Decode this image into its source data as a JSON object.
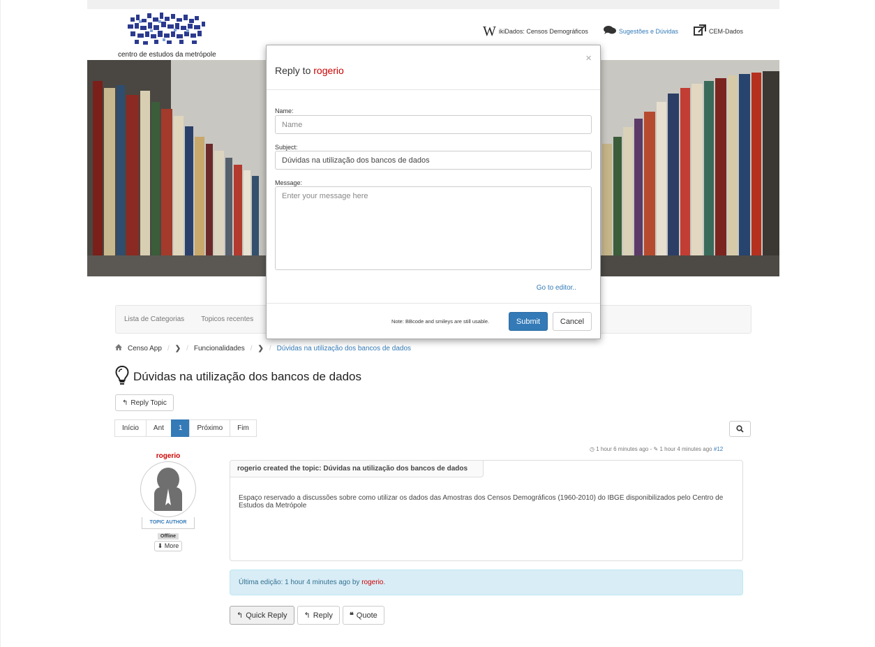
{
  "header": {
    "logo_text": "centro de estudos da metrópole",
    "links": [
      {
        "icon": "wikipedia-w-icon",
        "glyph": "W",
        "label": "ikiDados: Censos Demográficos"
      },
      {
        "icon": "comments-icon",
        "glyph": "💬",
        "label": "Sugestões e Dúvidas"
      },
      {
        "icon": "external-link-icon",
        "glyph": "⇱",
        "label": "CEM-Dados"
      }
    ]
  },
  "navbar": {
    "items": [
      "Lista de Categorias",
      "Topicos recentes"
    ]
  },
  "breadcrumb": {
    "home": "Censo App",
    "category": "Funcionalidades",
    "current": "Dúvidas na utilização dos bancos de dados"
  },
  "topic": {
    "title": "Dúvidas na utilização dos bancos de dados",
    "reply_topic_label": "Reply Topic"
  },
  "pagination": [
    "Início",
    "Ant",
    "1",
    "Próximo",
    "Fim"
  ],
  "post": {
    "meta_created": "1 hour 6 minutes ago",
    "meta_separator": "-",
    "meta_edited": "1 hour 4 minutes ago",
    "post_number": "#12",
    "author": "rogerio",
    "author_role": "TOPIC AUTHOR",
    "status": "Offline",
    "more_label": "More",
    "header": "rogerio created the topic: Dúvidas na utilização dos bancos de dados",
    "body": "Espaço reservado a discussões sobre como utilizar os dados das Amostras dos Censos Demográficos (1960-2010) do IBGE disponibilizados pelo Centro de Estudos da Metrópole",
    "edited_prefix": "Última edição: 1 hour 4 minutes ago by",
    "edited_user": "rogerio",
    "edited_suffix": "."
  },
  "post_actions": {
    "quick_reply": "Quick Reply",
    "reply": "Reply",
    "quote": "Quote"
  },
  "modal": {
    "close": "×",
    "title_prefix": "Reply to",
    "title_user": "rogerio",
    "name_label": "Name:",
    "name_placeholder": "Name",
    "subject_label": "Subject:",
    "subject_value": "Dúvidas na utilização dos bancos de dados",
    "message_label": "Message:",
    "message_placeholder": "Enter your message here",
    "editor_link": "Go to editor..",
    "note": "Note: BBcode and smileys are still usable.",
    "submit": "Submit",
    "cancel": "Cancel"
  },
  "colors": {
    "accent": "#337ab7",
    "username": "#cc0000",
    "info_bg": "#d9edf7"
  }
}
